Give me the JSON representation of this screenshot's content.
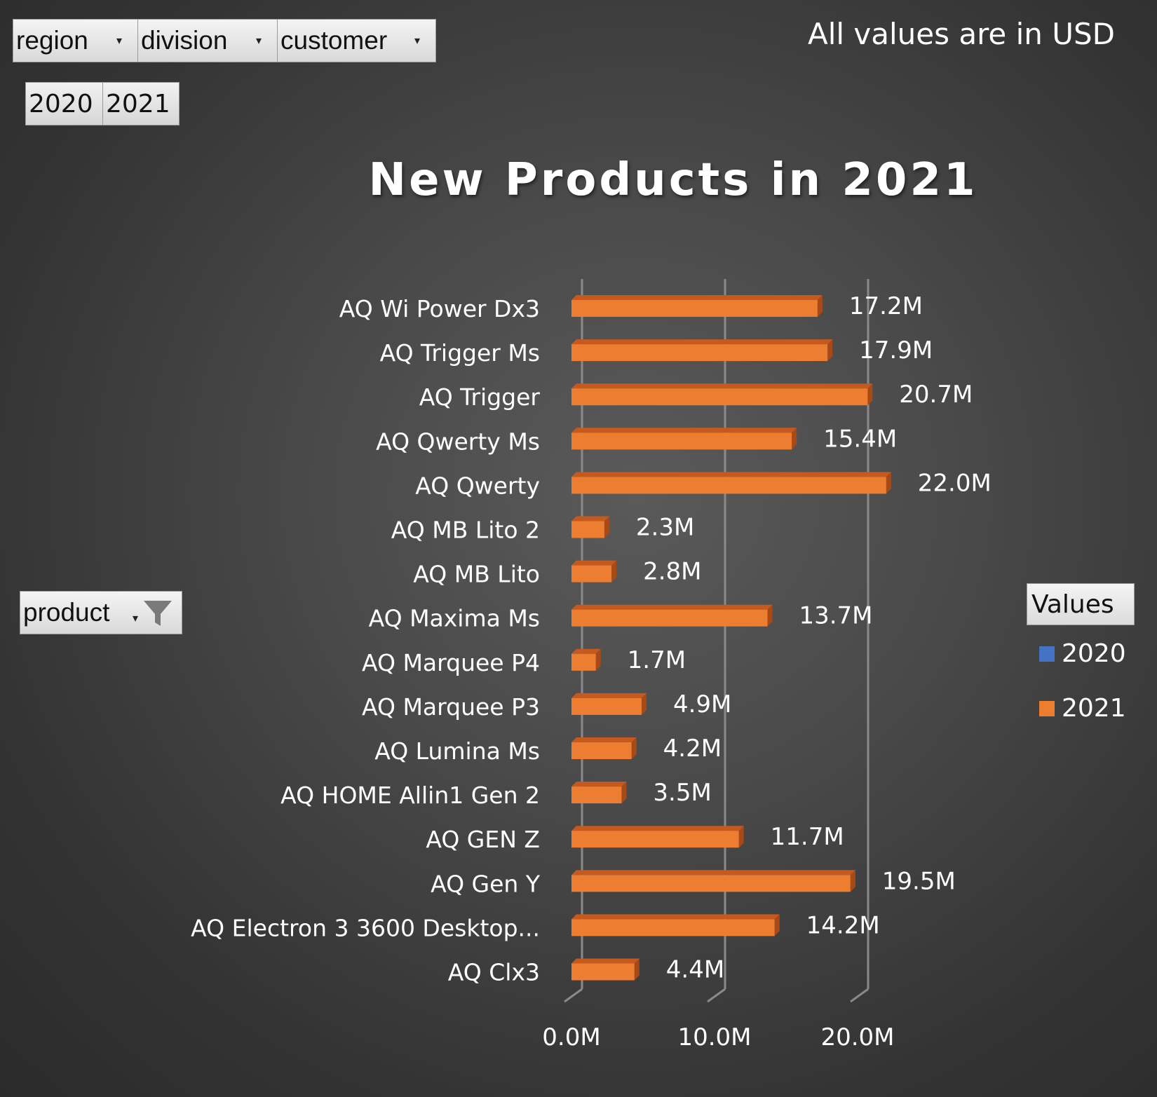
{
  "filters": {
    "region": "region",
    "division": "division",
    "customer": "customer",
    "product": "product"
  },
  "years": [
    "2020",
    "2021"
  ],
  "note": "All values are in USD",
  "legend": {
    "title": "Values",
    "items": [
      {
        "label": "2020",
        "color": "#4472c4"
      },
      {
        "label": "2021",
        "color": "#ed7d31"
      }
    ]
  },
  "icons": {
    "filter": "funnel-icon",
    "dropdown": "dropdown-arrow-icon"
  },
  "chart_data": {
    "type": "bar",
    "orientation": "horizontal",
    "title": "New Products in 2021",
    "categories": [
      "AQ Wi Power Dx3",
      "AQ Trigger Ms",
      "AQ Trigger",
      "AQ Qwerty Ms",
      "AQ Qwerty",
      "AQ MB Lito 2",
      "AQ MB Lito",
      "AQ Maxima Ms",
      "AQ Marquee P4",
      "AQ Marquee P3",
      "AQ Lumina Ms",
      "AQ HOME Allin1 Gen 2",
      "AQ GEN Z",
      "AQ Gen Y",
      "AQ Electron 3 3600 Desktop...",
      "AQ Clx3"
    ],
    "series": [
      {
        "name": "2021",
        "color": "#ed7d31",
        "values": [
          17.2,
          17.9,
          20.7,
          15.4,
          22.0,
          2.3,
          2.8,
          13.7,
          1.7,
          4.9,
          4.2,
          3.5,
          11.7,
          19.5,
          14.2,
          4.4
        ],
        "labels": [
          "17.2M",
          "17.9M",
          "20.7M",
          "15.4M",
          "22.0M",
          "2.3M",
          "2.8M",
          "13.7M",
          "1.7M",
          "4.9M",
          "4.2M",
          "3.5M",
          "11.7M",
          "19.5M",
          "14.2M",
          "4.4M"
        ]
      }
    ],
    "x_ticks": [
      "0.0M",
      "10.0M",
      "20.0M"
    ],
    "x_tick_values": [
      0,
      10,
      20
    ],
    "xlim": [
      0,
      20
    ],
    "unit": "millions USD",
    "grid": true,
    "legend_position": "right"
  }
}
